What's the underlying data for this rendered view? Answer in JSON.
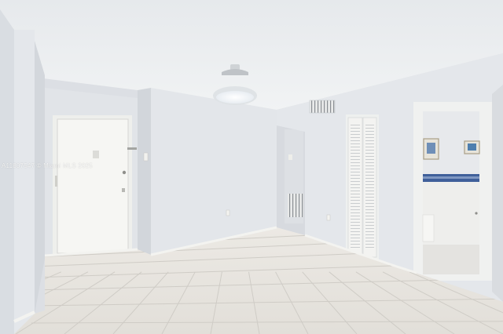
{
  "watermark": {
    "text": "A11807547 © Miami MLS 2025"
  },
  "palette": {
    "ceiling": "#eceff1",
    "wall": "#e3e6ea",
    "wall_shadow": "#cfd3d8",
    "floor": "#e8e6e2",
    "grout": "#cdcac4",
    "door": "#f7f7f5",
    "baseboard": "#f2f2ef",
    "light": "#ffffff",
    "tile_blue": "#3f5f9a"
  }
}
